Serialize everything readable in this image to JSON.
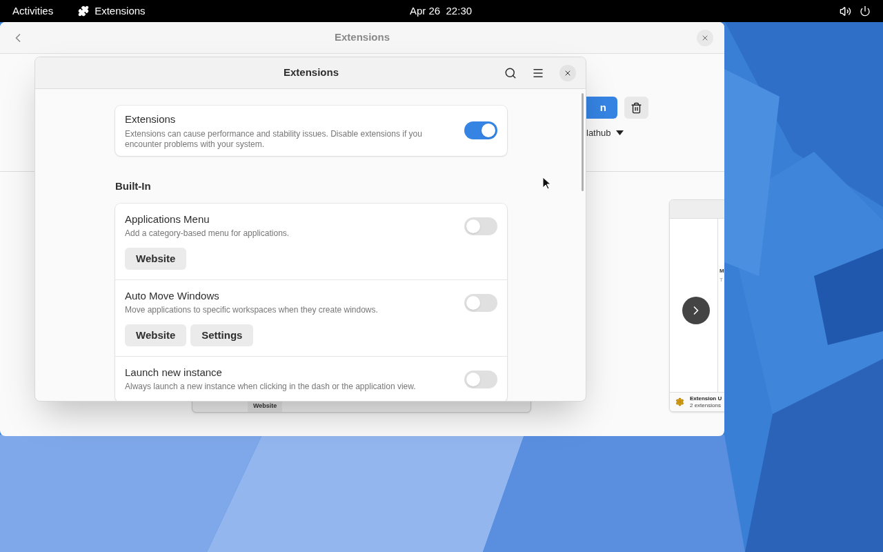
{
  "top_bar": {
    "activities": "Activities",
    "app_name": "Extensions",
    "clock": "Apr 26  22:30"
  },
  "background_window": {
    "title": "Extensions",
    "install_button": "n",
    "source": "lathub",
    "screenshot_letters": [
      "M",
      "T"
    ],
    "screenshot_caption": {
      "title": "Extension U",
      "subtitle": "2 extensions"
    },
    "lower_button": "Website"
  },
  "dialog": {
    "title": "Extensions",
    "master": {
      "title": "Extensions",
      "description": "Extensions can cause performance and stability issues. Disable extensions if you encounter problems with your system.",
      "on": true
    },
    "section": "Built-In",
    "extensions": [
      {
        "name": "Applications Menu",
        "description": "Add a category-based menu for applications.",
        "on": false,
        "buttons": [
          "Website"
        ]
      },
      {
        "name": "Auto Move Windows",
        "description": "Move applications to specific workspaces when they create windows.",
        "on": false,
        "buttons": [
          "Website",
          "Settings"
        ]
      },
      {
        "name": "Launch new instance",
        "description": "Always launch a new instance when clicking in the dash or the application view.",
        "on": false
      }
    ]
  }
}
